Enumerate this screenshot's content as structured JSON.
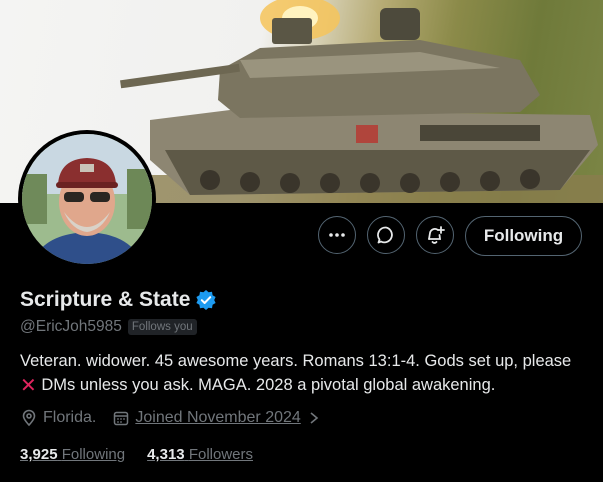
{
  "banner": {
    "alt": "tank"
  },
  "profile": {
    "display_name": "Scripture & State",
    "handle": "@EricJoh5985",
    "follows_you": "Follows you",
    "bio_part1": "Veteran. widower. 45 awesome years.  Romans 13:1-4. Gods set up, please ",
    "bio_part2": " DMs unless you ask. MAGA. 2028 a pivotal global awakening.",
    "bio_emoji": "cross-mark",
    "location": "Florida.",
    "joined": "Joined November 2024",
    "following_count": "3,925",
    "following_label": "Following",
    "followers_count": "4,313",
    "followers_label": "Followers"
  },
  "actions": {
    "more": "more-icon",
    "message": "message-icon",
    "notify": "bell-plus-icon",
    "follow_state": "Following"
  },
  "colors": {
    "background": "#000000",
    "text": "#e7e9ea",
    "muted": "#71767b",
    "border": "#536471",
    "verified": "#1d9bf0"
  }
}
